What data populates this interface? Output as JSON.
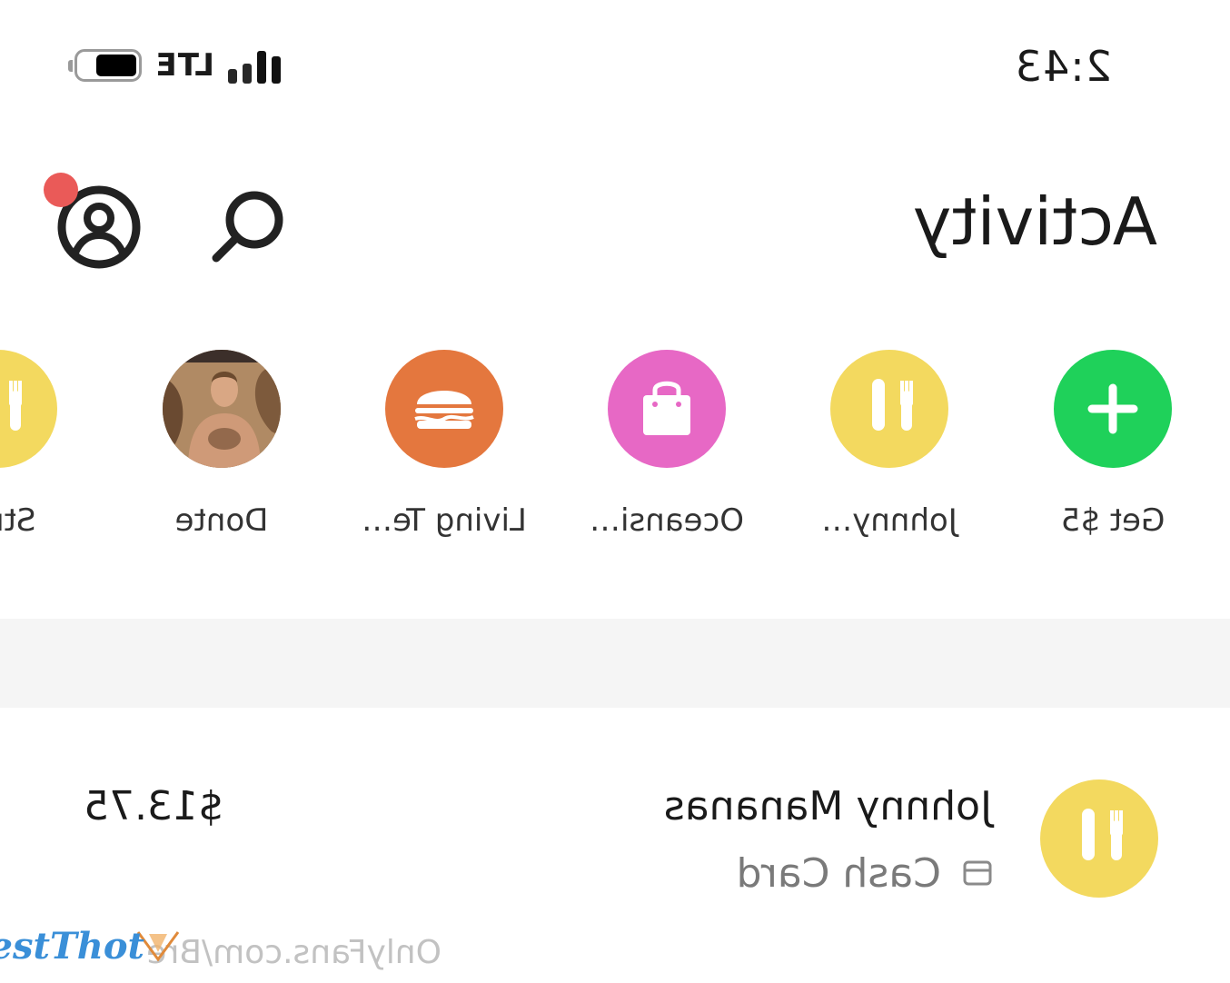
{
  "status_bar": {
    "time": "2:43",
    "network": "LTE",
    "signal_bars_active": 2,
    "signal_bars_total": 4
  },
  "header": {
    "title": "Activity",
    "search_icon": "search-icon",
    "profile_icon": "profile-icon",
    "notification_dot_color": "#ea5a58"
  },
  "recent": {
    "items": [
      {
        "label": "Get $5",
        "icon": "plus-icon",
        "color": "#1fd15a"
      },
      {
        "label": "Johnny…",
        "icon": "fork-knife-icon",
        "color": "#f3d95f"
      },
      {
        "label": "Oceansi…",
        "icon": "shopping-bag-icon",
        "color": "#e768c5"
      },
      {
        "label": "Living Te…",
        "icon": "burger-icon",
        "color": "#e4773e"
      },
      {
        "label": "Donte",
        "icon": "photo-avatar",
        "color": "#8a6a4a"
      },
      {
        "label": "Strat",
        "icon": "fork-knife-icon",
        "color": "#f3d95f"
      }
    ]
  },
  "transactions": [
    {
      "name": "Johnny Mananas",
      "method": "Cash Card",
      "amount": "$13.75",
      "icon": "fork-knife-icon",
      "color": "#f3d95f"
    }
  ],
  "watermark": {
    "url": "OnlyFans.com/Bre",
    "logo_text": "BestThot"
  }
}
